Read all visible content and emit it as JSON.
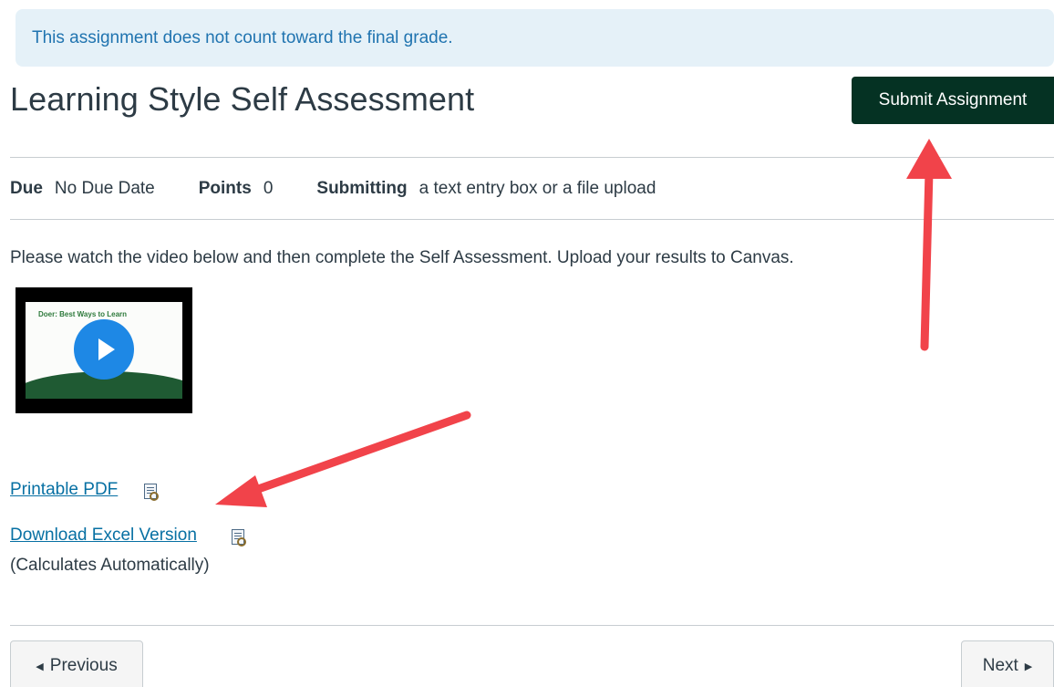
{
  "notice": {
    "text": "This assignment does not count toward the final grade."
  },
  "header": {
    "title": "Learning Style Self Assessment",
    "submit_label": "Submit Assignment"
  },
  "details": {
    "due_label": "Due",
    "due_value": "No Due Date",
    "points_label": "Points",
    "points_value": "0",
    "submitting_label": "Submitting",
    "submitting_value": "a text entry box or a file upload"
  },
  "body": {
    "instructions": "Please watch the video below and then complete the Self Assessment. Upload your results to Canvas.",
    "video_slide_title": "Doer: Best Ways to Learn",
    "links": {
      "pdf": "Printable PDF",
      "excel": "Download Excel Version"
    },
    "excel_note": "(Calculates Automatically)"
  },
  "footer": {
    "previous_label": "Previous",
    "next_label": "Next"
  },
  "colors": {
    "accent_dark_green": "#053223",
    "link_blue": "#0770a3",
    "notice_bg": "#e5f1f8",
    "annotation_red": "#f1434a"
  },
  "icons": [
    "play-icon",
    "document-preview-icon",
    "caret-left-icon",
    "caret-right-icon"
  ]
}
